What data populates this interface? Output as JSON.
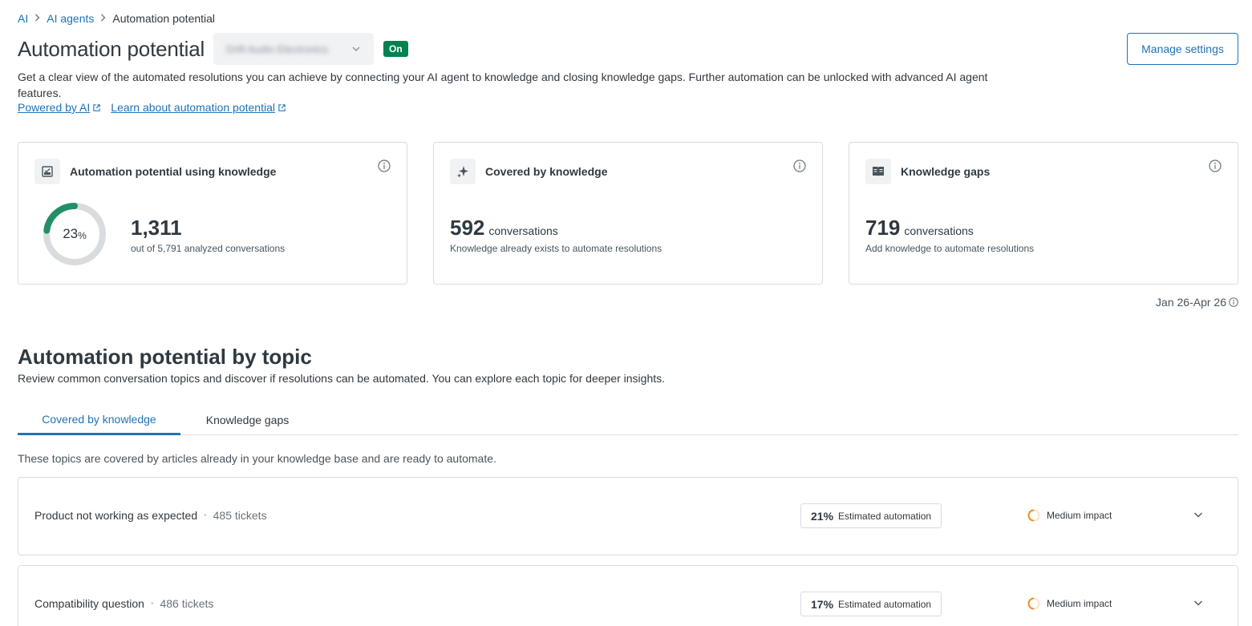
{
  "breadcrumb": [
    {
      "label": "AI"
    },
    {
      "label": "AI agents"
    },
    {
      "label": "Automation potential"
    }
  ],
  "header": {
    "title": "Automation potential",
    "brand_select_value": "Drift Audio Electronics",
    "status_badge": "On",
    "manage_button": "Manage settings",
    "description": "Get a clear view of the automated resolutions you can achieve by connecting your AI agent to knowledge and closing knowledge gaps. Further automation can be unlocked with advanced AI agent features.",
    "links": {
      "powered_by_ai": "Powered by AI",
      "learn_more": "Learn about automation potential"
    }
  },
  "cards": {
    "automation": {
      "title": "Automation potential using knowledge",
      "percent_value": "23",
      "percent_symbol": "%",
      "percent_fraction": 0.23,
      "value": "1,311",
      "sub": "out of 5,791 analyzed conversations",
      "icon": "checkbox-chart-icon"
    },
    "covered": {
      "title": "Covered by knowledge",
      "value": "592",
      "unit": "conversations",
      "sub": "Knowledge already exists to automate resolutions",
      "icon": "sparkle-icon"
    },
    "gaps": {
      "title": "Knowledge gaps",
      "value": "719",
      "unit": "conversations",
      "sub": "Add knowledge to automate resolutions",
      "icon": "book-icon"
    }
  },
  "date_range": "Jan 26-Apr 26",
  "topics_section": {
    "title": "Automation potential by topic",
    "description": "Review common conversation topics and discover if resolutions can be automated. You can explore each topic for deeper insights.",
    "tabs": [
      {
        "label": "Covered by knowledge",
        "active": true
      },
      {
        "label": "Knowledge gaps",
        "active": false
      }
    ],
    "tab_description": "These topics are covered by articles already in your knowledge base and are ready to automate.",
    "rows": [
      {
        "topic": "Product not working as expected",
        "tickets": "485 tickets",
        "automation_percent": "21%",
        "automation_label": "Estimated automation",
        "impact": "Medium impact"
      },
      {
        "topic": "Compatibility question",
        "tickets": "486 tickets",
        "automation_percent": "17%",
        "automation_label": "Estimated automation",
        "impact": "Medium impact"
      }
    ]
  },
  "colors": {
    "accent": "#1f73b7",
    "success": "#038153",
    "donut_fill": "#228f67",
    "donut_track": "#d8dcde",
    "impact_orange": "#ed8f1c"
  }
}
